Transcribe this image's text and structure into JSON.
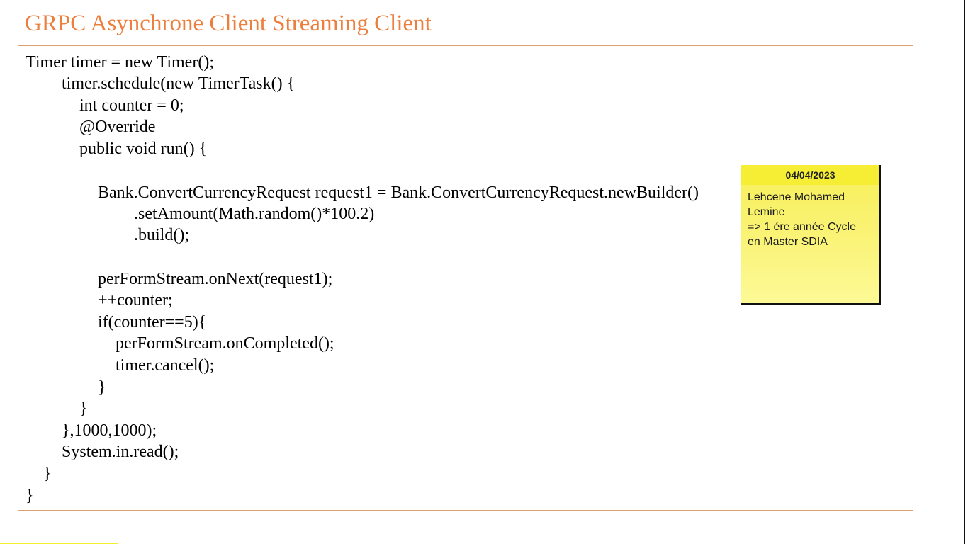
{
  "slide": {
    "title": "GRPC Asynchrone Client Streaming Client"
  },
  "code": {
    "lines": [
      "Timer timer = new Timer();",
      "timer.schedule(new TimerTask() {",
      "int counter = 0;",
      "@Override",
      "public void run() {",
      "Bank.ConvertCurrencyRequest request1 = Bank.ConvertCurrencyRequest.newBuilder()",
      ".setAmount(Math.random()*100.2)",
      ".build();",
      "perFormStream.onNext(request1);",
      "++counter;",
      "if(counter==5){",
      "perFormStream.onCompleted();",
      "timer.cancel();",
      "}",
      "}",
      "},1000,1000);",
      "System.in.read();",
      "}",
      "}"
    ]
  },
  "note": {
    "date": "04/04/2023",
    "lines": [
      "Lehcene Mohamed",
      "Lemine",
      "=> 1 ére année Cycle",
      "en Master SDIA"
    ]
  },
  "colors": {
    "title": "#ec7f3d",
    "code_border": "#e0a070",
    "note_background": "#f9f272",
    "note_header": "#f5ee35",
    "bottom_accent": "#f3ee2a"
  }
}
